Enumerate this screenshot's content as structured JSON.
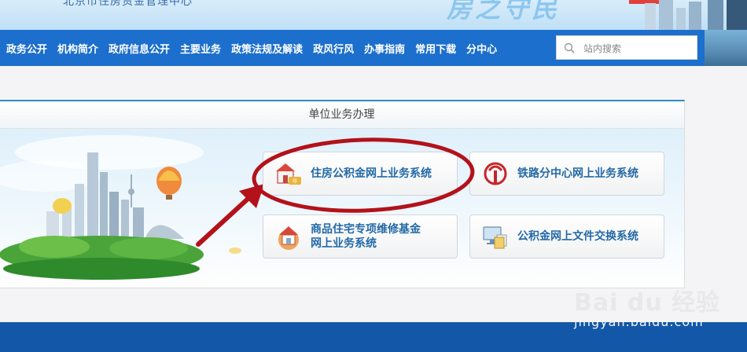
{
  "header": {
    "org_name": "北京市住房资金管理中心",
    "slogan": "房之守民"
  },
  "nav": {
    "items": [
      "政务公开",
      "机构简介",
      "政府信息公开",
      "主要业务",
      "政策法规及解读",
      "政风行风",
      "办事指南",
      "常用下载",
      "分中心"
    ]
  },
  "search": {
    "placeholder": "站内搜索"
  },
  "panel": {
    "title": "单位业务办理",
    "services": [
      {
        "label": "住房公积金网上业务系统"
      },
      {
        "label": "铁路分中心网上业务系统"
      },
      {
        "label_line1": "商品住宅专项维修基金",
        "label_line2": "网上业务系统"
      },
      {
        "label": "公积金网上文件交换系统"
      }
    ]
  },
  "watermark": {
    "brand": "Bai du 经验",
    "url": "jingyan.baidu.com"
  },
  "colors": {
    "nav_bg": "#1c6fcc",
    "annotation": "#b3121b",
    "service_text": "#2369a6",
    "footer": "#1357a8"
  }
}
